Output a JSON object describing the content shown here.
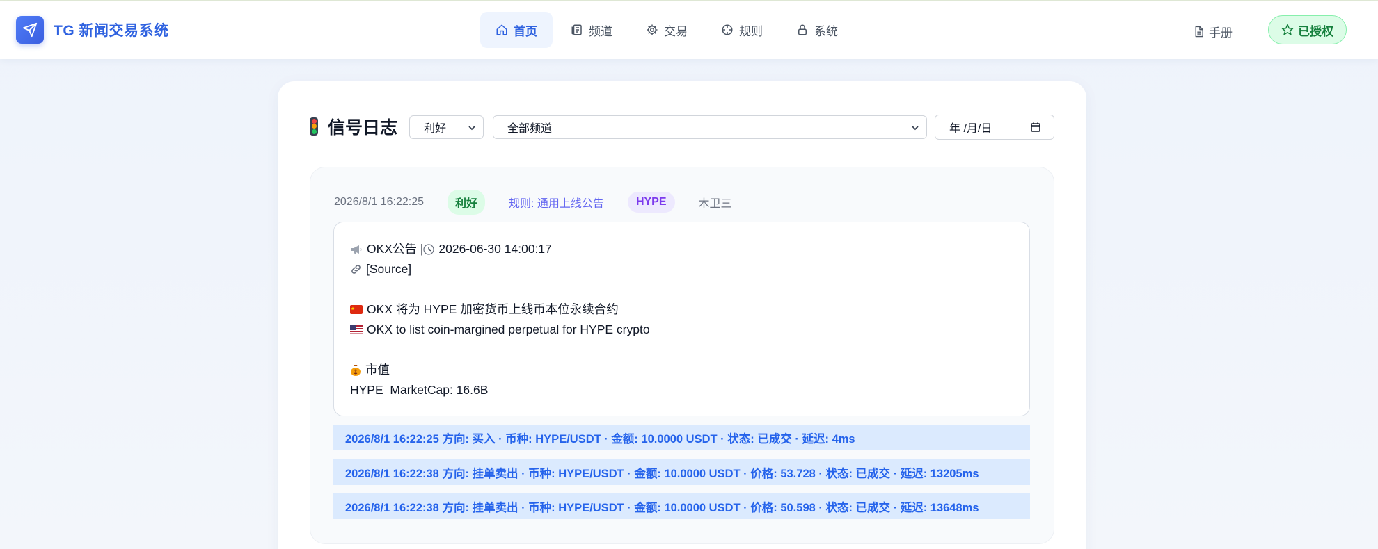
{
  "app": {
    "title": "TG 新闻交易系统"
  },
  "nav": {
    "items": [
      {
        "label": "首页",
        "icon": "home-icon",
        "active": true
      },
      {
        "label": "频道",
        "icon": "newspaper-icon",
        "active": false
      },
      {
        "label": "交易",
        "icon": "gear-icon",
        "active": false
      },
      {
        "label": "规则",
        "icon": "crosshair-icon",
        "active": false
      },
      {
        "label": "系统",
        "icon": "lock-icon",
        "active": false
      }
    ],
    "manual_label": "手册",
    "licensed_label": "已授权"
  },
  "log": {
    "title": "信号日志",
    "filters": {
      "sentiment": "利好",
      "channel": "全部频道",
      "date_placeholder": "年 /月/日"
    },
    "entry": {
      "time": "2026/8/1 16:22:25",
      "sentiment": "利好",
      "rule": "规则: 通用上线公告",
      "coin": "HYPE",
      "channel": "木卫三",
      "message": {
        "line1": "OKX公告 | ",
        "line1_time": "2026-06-30 14:00:17",
        "line2": "[Source]",
        "line3": "OKX 将为 HYPE 加密货币上线币本位永续合约",
        "line4": "OKX to list coin-margined perpetual for HYPE crypto",
        "line5": "市值",
        "line6": "HYPE  MarketCap: 16.6B"
      },
      "trades": [
        "2026/8/1 16:22:25 方向: 买入 · 币种: HYPE/USDT · 金额: 10.0000 USDT · 状态: 已成交 · 延迟: 4ms",
        "2026/8/1 16:22:38 方向: 挂单卖出 · 币种: HYPE/USDT · 金额: 10.0000 USDT · 价格: 53.728 · 状态: 已成交 · 延迟: 13205ms",
        "2026/8/1 16:22:38 方向: 挂单卖出 · 币种: HYPE/USDT · 金额: 10.0000 USDT · 价格: 50.598 · 状态: 已成交 · 延迟: 13648ms"
      ]
    }
  },
  "colors": {
    "accent": "#2f62e0",
    "good_badge": "#15803d",
    "coin_badge": "#7c3aed",
    "trade_bg": "#dbeafe"
  }
}
